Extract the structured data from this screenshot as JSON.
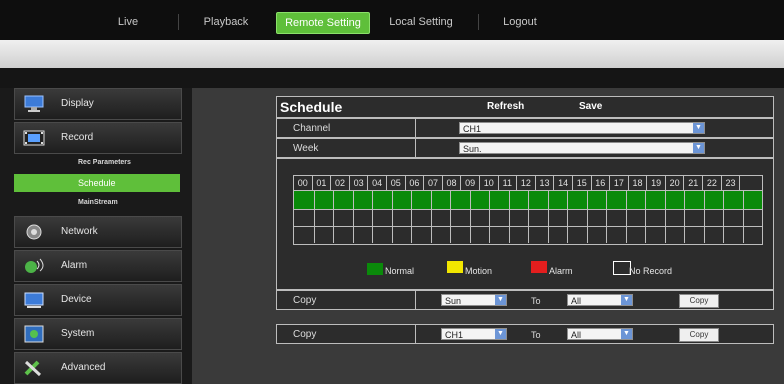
{
  "nav": {
    "tabs": [
      {
        "label": "Live"
      },
      {
        "label": "Playback"
      },
      {
        "label": "Remote Setting"
      },
      {
        "label": "Local Setting"
      },
      {
        "label": "Logout"
      }
    ]
  },
  "sidebar": {
    "items": [
      {
        "label": "Display"
      },
      {
        "label": "Record"
      },
      {
        "label": "Network"
      },
      {
        "label": "Alarm"
      },
      {
        "label": "Device"
      },
      {
        "label": "System"
      },
      {
        "label": "Advanced"
      }
    ],
    "record_subitems": [
      {
        "label": "Rec Parameters"
      },
      {
        "label": "Schedule"
      },
      {
        "label": "MainStream"
      }
    ]
  },
  "schedule": {
    "title": "Schedule",
    "refresh_label": "Refresh",
    "save_label": "Save",
    "channel_label": "Channel",
    "channel_value": "CH1",
    "week_label": "Week",
    "week_value": "Sun.",
    "hours": [
      "00",
      "01",
      "02",
      "03",
      "04",
      "05",
      "06",
      "07",
      "08",
      "09",
      "10",
      "11",
      "12",
      "13",
      "14",
      "15",
      "16",
      "17",
      "18",
      "19",
      "20",
      "21",
      "22",
      "23"
    ],
    "legend": [
      {
        "label": "Normal",
        "color": "#0a8a0a"
      },
      {
        "label": "Motion",
        "color": "#f2e600"
      },
      {
        "label": "Alarm",
        "color": "#e31e1e"
      },
      {
        "label": "No Record",
        "color": "#ffffff"
      }
    ],
    "copy1": {
      "label": "Copy",
      "from": "Sun",
      "to_label": "To",
      "to": "All",
      "button": "Copy"
    },
    "copy2": {
      "label": "Copy",
      "from": "CH1",
      "to_label": "To",
      "to": "All",
      "button": "Copy"
    }
  }
}
